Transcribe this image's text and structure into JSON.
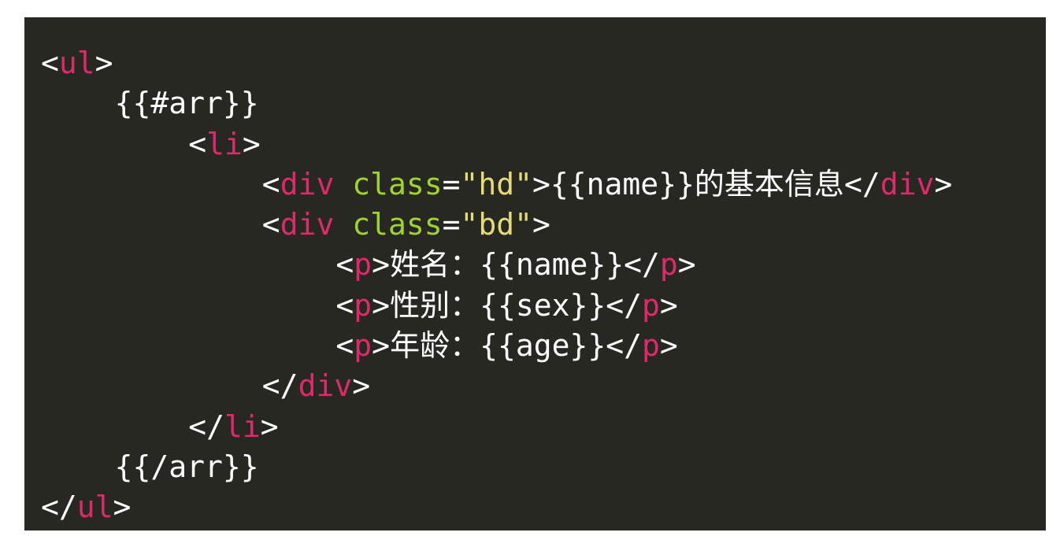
{
  "colors": {
    "background": "#272822",
    "punctuation": "#ffffff",
    "tag": "#e0296c",
    "attribute": "#9fd42b",
    "string": "#e6db74",
    "text": "#ffffff"
  },
  "lines": [
    {
      "indent": 0,
      "tokens": [
        {
          "t": "<",
          "k": "punctuation"
        },
        {
          "t": "ul",
          "k": "tag"
        },
        {
          "t": ">",
          "k": "punctuation"
        }
      ]
    },
    {
      "indent": 4,
      "tokens": [
        {
          "t": "{{#arr}}",
          "k": "text"
        }
      ]
    },
    {
      "indent": 8,
      "tokens": [
        {
          "t": "<",
          "k": "punctuation"
        },
        {
          "t": "li",
          "k": "tag"
        },
        {
          "t": ">",
          "k": "punctuation"
        }
      ]
    },
    {
      "indent": 12,
      "tokens": [
        {
          "t": "<",
          "k": "punctuation"
        },
        {
          "t": "div",
          "k": "tag"
        },
        {
          "t": " ",
          "k": "text"
        },
        {
          "t": "class",
          "k": "attribute"
        },
        {
          "t": "=",
          "k": "punctuation"
        },
        {
          "t": "\"hd\"",
          "k": "string"
        },
        {
          "t": ">",
          "k": "punctuation"
        },
        {
          "t": "{{name}}的基本信息",
          "k": "text"
        },
        {
          "t": "</",
          "k": "punctuation"
        },
        {
          "t": "div",
          "k": "tag"
        },
        {
          "t": ">",
          "k": "punctuation"
        }
      ]
    },
    {
      "indent": 12,
      "tokens": [
        {
          "t": "<",
          "k": "punctuation"
        },
        {
          "t": "div",
          "k": "tag"
        },
        {
          "t": " ",
          "k": "text"
        },
        {
          "t": "class",
          "k": "attribute"
        },
        {
          "t": "=",
          "k": "punctuation"
        },
        {
          "t": "\"bd\"",
          "k": "string"
        },
        {
          "t": ">",
          "k": "punctuation"
        }
      ]
    },
    {
      "indent": 16,
      "tokens": [
        {
          "t": "<",
          "k": "punctuation"
        },
        {
          "t": "p",
          "k": "tag"
        },
        {
          "t": ">",
          "k": "punctuation"
        },
        {
          "t": "姓名：{{name}}",
          "k": "text"
        },
        {
          "t": "</",
          "k": "punctuation"
        },
        {
          "t": "p",
          "k": "tag"
        },
        {
          "t": ">",
          "k": "punctuation"
        }
      ]
    },
    {
      "indent": 16,
      "tokens": [
        {
          "t": "<",
          "k": "punctuation"
        },
        {
          "t": "p",
          "k": "tag"
        },
        {
          "t": ">",
          "k": "punctuation"
        },
        {
          "t": "性别：{{sex}}",
          "k": "text"
        },
        {
          "t": "</",
          "k": "punctuation"
        },
        {
          "t": "p",
          "k": "tag"
        },
        {
          "t": ">",
          "k": "punctuation"
        }
      ]
    },
    {
      "indent": 16,
      "tokens": [
        {
          "t": "<",
          "k": "punctuation"
        },
        {
          "t": "p",
          "k": "tag"
        },
        {
          "t": ">",
          "k": "punctuation"
        },
        {
          "t": "年龄：{{age}}",
          "k": "text"
        },
        {
          "t": "</",
          "k": "punctuation"
        },
        {
          "t": "p",
          "k": "tag"
        },
        {
          "t": ">",
          "k": "punctuation"
        }
      ]
    },
    {
      "indent": 12,
      "tokens": [
        {
          "t": "</",
          "k": "punctuation"
        },
        {
          "t": "div",
          "k": "tag"
        },
        {
          "t": ">",
          "k": "punctuation"
        }
      ]
    },
    {
      "indent": 8,
      "tokens": [
        {
          "t": "</",
          "k": "punctuation"
        },
        {
          "t": "li",
          "k": "tag"
        },
        {
          "t": ">",
          "k": "punctuation"
        }
      ]
    },
    {
      "indent": 4,
      "tokens": [
        {
          "t": "{{/arr}}",
          "k": "text"
        }
      ]
    },
    {
      "indent": 0,
      "tokens": [
        {
          "t": "</",
          "k": "punctuation"
        },
        {
          "t": "ul",
          "k": "tag"
        },
        {
          "t": ">",
          "k": "punctuation"
        }
      ]
    }
  ]
}
